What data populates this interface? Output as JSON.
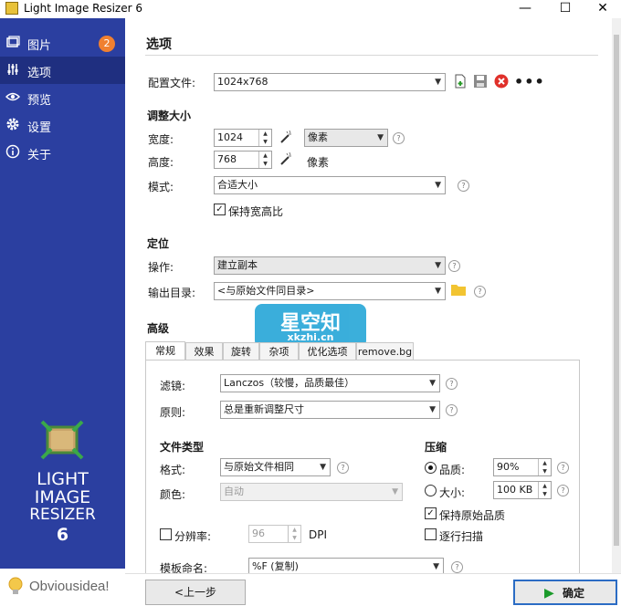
{
  "window": {
    "title": "Light Image Resizer 6",
    "min": "—",
    "max": "☐",
    "close": "✕"
  },
  "sidebar": {
    "items": [
      {
        "label": "图片",
        "icon": "images-icon"
      },
      {
        "label": "选项",
        "icon": "sliders-icon"
      },
      {
        "label": "预览",
        "icon": "eye-icon"
      },
      {
        "label": "设置",
        "icon": "gear-icon"
      },
      {
        "label": "关于",
        "icon": "info-icon"
      }
    ],
    "badge": "2",
    "logo_line1": "LIGHT",
    "logo_line2": "IMAGE",
    "logo_line3": "RESIZER",
    "logo_line4": "6",
    "brand": "Obviousidea!"
  },
  "options": {
    "heading": "选项",
    "profile_label": "配置文件:",
    "profile_value": "1024x768",
    "resize_heading": "调整大小",
    "width_label": "宽度:",
    "width_value": "1024",
    "unit_value": "像素",
    "height_label": "高度:",
    "height_value": "768",
    "height_unit": "像素",
    "mode_label": "模式:",
    "mode_value": "合适大小",
    "keep_ratio": "保持宽高比",
    "position_heading": "定位",
    "action_label": "操作:",
    "action_value": "建立副本",
    "output_label": "输出目录:",
    "output_value": "<与原始文件同目录>",
    "advanced_heading": "高级"
  },
  "tabs": [
    "常规",
    "效果",
    "旋转",
    "杂项",
    "优化选项",
    "remove.bg"
  ],
  "general": {
    "filter_label": "滤镜:",
    "filter_value": "Lanczos（较慢，品质最佳）",
    "rule_label": "原则:",
    "rule_value": "总是重新调整尺寸",
    "filetype_heading": "文件类型",
    "format_label": "格式:",
    "format_value": "与原始文件相同",
    "color_label": "颜色:",
    "color_value": "自动",
    "compress_heading": "压缩",
    "quality_label": "品质:",
    "quality_value": "90%",
    "size_label": "大小:",
    "size_value": "100 KB",
    "keep_quality": "保持原始品质",
    "progressive": "逐行扫描",
    "resolution_label": "分辨率:",
    "resolution_value": "96",
    "dpi": "DPI",
    "template_label": "模板命名:",
    "template_value": "%F (复制)"
  },
  "watermark": {
    "line1": "星空知",
    "line2": "xkzhi.cn"
  },
  "buttons": {
    "back": "<上一步",
    "ok": "确定"
  },
  "colors": {
    "sidebar": "#2b3fa0",
    "badge": "#f08030",
    "delete": "#e0302a",
    "ok_arrow": "#1a9a2a",
    "watermark": "#2aa8d8"
  }
}
